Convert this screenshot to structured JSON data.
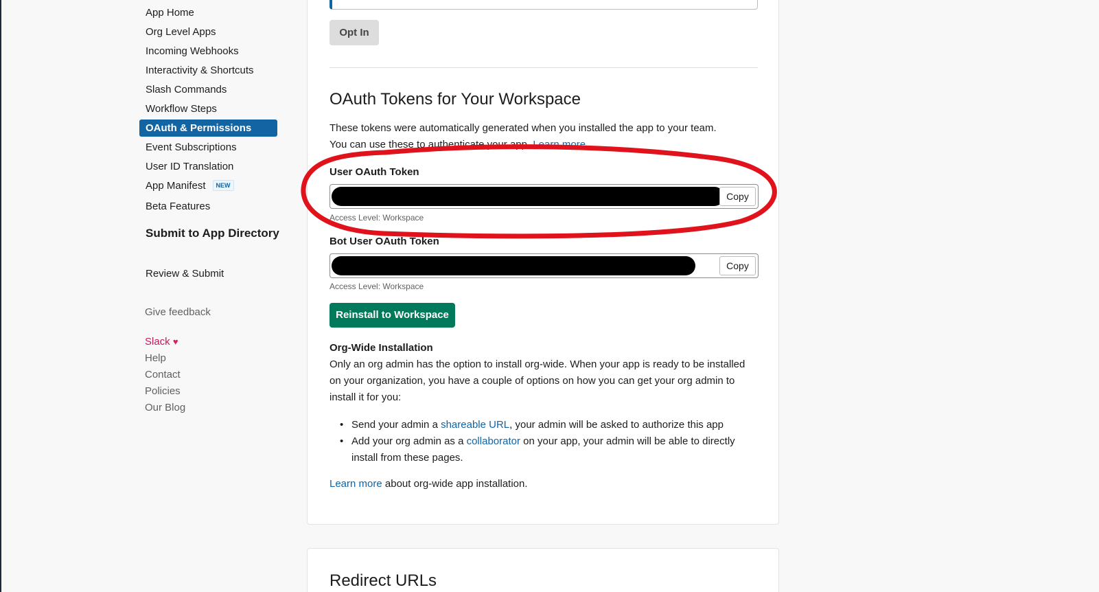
{
  "sidebar": {
    "items": [
      {
        "label": "App Home"
      },
      {
        "label": "Org Level Apps"
      },
      {
        "label": "Incoming Webhooks"
      },
      {
        "label": "Interactivity & Shortcuts"
      },
      {
        "label": "Slash Commands"
      },
      {
        "label": "Workflow Steps"
      },
      {
        "label": "OAuth & Permissions",
        "active": true
      },
      {
        "label": "Event Subscriptions"
      },
      {
        "label": "User ID Translation"
      },
      {
        "label": "App Manifest",
        "badge": "NEW"
      },
      {
        "label": "Beta Features"
      }
    ],
    "submit_heading": "Submit to App Directory",
    "review_label": "Review & Submit",
    "feedback_label": "Give feedback",
    "footer": {
      "slack": "Slack",
      "heart_icon": "heart-icon",
      "help": "Help",
      "contact": "Contact",
      "policies": "Policies",
      "blog": "Our Blog"
    }
  },
  "main": {
    "opt_in_label": "Opt In",
    "oauth_title": "OAuth Tokens for Your Workspace",
    "intro_text": "These tokens were automatically generated when you installed the app to your team.",
    "intro_text2": "You can use these to authenticate your app.",
    "intro_link": "Learn more",
    "user_token_label": "User OAuth Token",
    "bot_token_label": "Bot User OAuth Token",
    "copy_label": "Copy",
    "access_level": "Access Level: Workspace",
    "reinstall_label": "Reinstall to Workspace",
    "org_wide_title": "Org-Wide Installation",
    "org_wide_text": "Only an org admin has the option to install org-wide. When your app is ready to be installed on your organization, you have a couple of options on how you can get your org admin to install it for you:",
    "bullet1_pre": "Send your admin a ",
    "bullet1_link": "shareable URL",
    "bullet1_post": ", your admin will be asked to authorize this app",
    "bullet2_pre": "Add your org admin as a ",
    "bullet2_link": "collaborator",
    "bullet2_post": " on your app, your admin will be able to directly install from these pages.",
    "learn_more_link": "Learn more",
    "learn_more_post": " about org-wide app installation.",
    "redirect_title": "Redirect URLs"
  },
  "colors": {
    "accent": "#1264a3",
    "install_green": "#007a5a",
    "annotation_red": "#e0121c",
    "redaction": "#000000"
  }
}
